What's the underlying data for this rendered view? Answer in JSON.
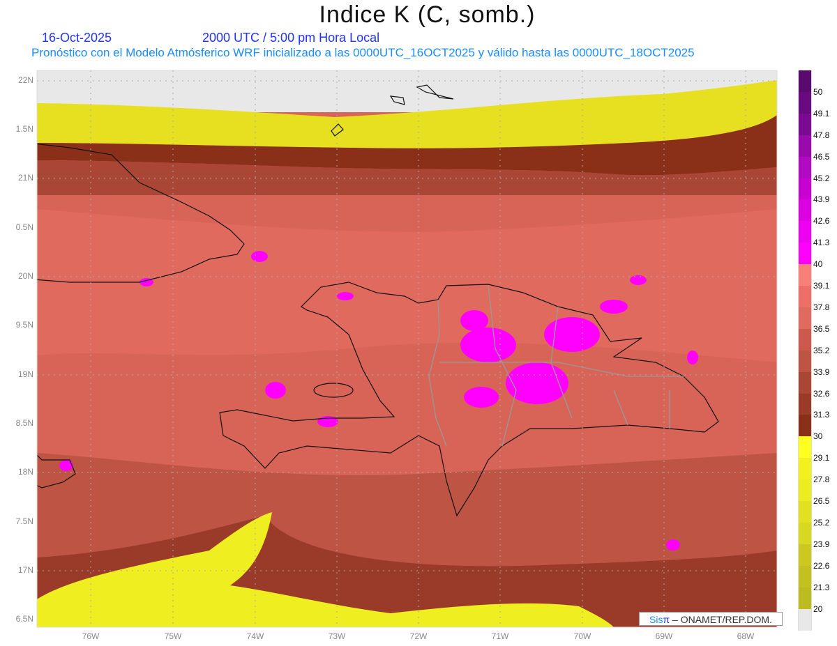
{
  "header": {
    "title": "Indice K (C, somb.)",
    "date": "16-Oct-2025",
    "time": "2000 UTC / 5:00 pm Hora Local",
    "subtitle": "Pronóstico con el Modelo Atmósferico WRF inicializado a las 0000UTC_16OCT2025 y válido hasta las  0000UTC_18OCT2025"
  },
  "axes": {
    "lat_labels": [
      "22N",
      "1.5N",
      "21N",
      "0.5N",
      "20N",
      "9.5N",
      "19N",
      "8.5N",
      "18N",
      "7.5N",
      "17N",
      "6.5N"
    ],
    "lon_labels": [
      "76W",
      "75W",
      "74W",
      "73W",
      "72W",
      "71W",
      "70W",
      "69W",
      "68W"
    ]
  },
  "colorbar": {
    "labels": [
      "50",
      "49.1",
      "47.8",
      "46.5",
      "45.2",
      "43.9",
      "42.6",
      "41.3",
      "40",
      "39.1",
      "37.8",
      "36.5",
      "35.2",
      "33.9",
      "32.6",
      "31.3",
      "30",
      "29.1",
      "27.8",
      "26.5",
      "25.2",
      "23.9",
      "22.6",
      "21.3",
      "20"
    ],
    "colors": [
      "#5a0a6e",
      "#6a0a80",
      "#7a0a92",
      "#980aac",
      "#b00ac2",
      "#c800d2",
      "#dc00e2",
      "#ee00f0",
      "#ff00ff",
      "#f88078",
      "#ec7068",
      "#e06a5e",
      "#cc5a4c",
      "#be5444",
      "#aa4636",
      "#9a3a28",
      "#8a3018",
      "#ffff20",
      "#f4f020",
      "#ecec20",
      "#e2e020",
      "#d8d820",
      "#ccc820",
      "#c4c020",
      "#bcbc20",
      "#e8e8e8"
    ]
  },
  "credit": {
    "sis": "Sis",
    "pi": "π",
    "rest": " –  ONAMET/REP.DOM."
  }
}
